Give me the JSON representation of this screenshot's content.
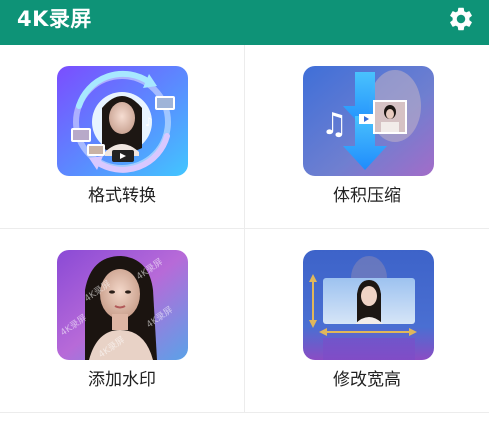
{
  "header": {
    "title": "4K录屏",
    "settings_icon": "gear-icon",
    "background_color": "#0e9377"
  },
  "tools": [
    {
      "label": "格式转换",
      "icon": "format-convert-thumbnail"
    },
    {
      "label": "体积压缩",
      "icon": "size-compress-thumbnail"
    },
    {
      "label": "添加水印",
      "icon": "add-watermark-thumbnail"
    },
    {
      "label": "修改宽高",
      "icon": "resize-thumbnail"
    }
  ],
  "thumbnails": {
    "watermark_text": "4K录屏"
  }
}
